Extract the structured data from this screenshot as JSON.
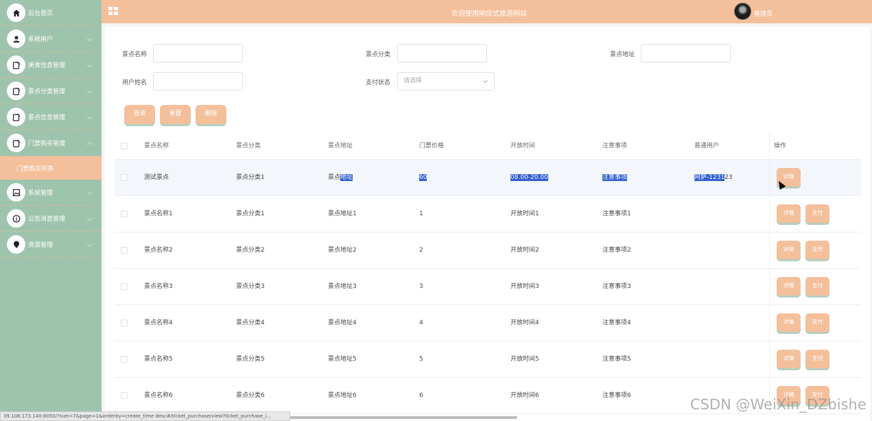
{
  "sidebar": {
    "items": [
      {
        "label": "后台首页",
        "icon": "home-icon"
      },
      {
        "label": "系统用户",
        "icon": "user-icon"
      },
      {
        "label": "美食信息管理",
        "icon": "edit-icon"
      },
      {
        "label": "景点分类管理",
        "icon": "edit-icon"
      },
      {
        "label": "景点信息管理",
        "icon": "edit-icon"
      },
      {
        "label": "门票购买管理",
        "icon": "edit-icon"
      },
      {
        "label": "门票购买列表",
        "icon": ""
      },
      {
        "label": "系统管理",
        "icon": "image-icon"
      },
      {
        "label": "公告消息管理",
        "icon": "info-icon"
      },
      {
        "label": "资源管理",
        "icon": "location-icon"
      }
    ]
  },
  "header": {
    "title": "欢迎使用响应式旅游网站",
    "user": "管理员"
  },
  "filters": {
    "name_label": "景点名称",
    "category_label": "景点分类",
    "address_label": "景点地址",
    "username_label": "用户姓名",
    "pay_status_label": "支付状态",
    "pay_status_placeholder": "请选择"
  },
  "actions": {
    "query": "查询",
    "reset": "重置",
    "delete": "删除"
  },
  "table": {
    "headers": [
      "景点名称",
      "景点分类",
      "景点地址",
      "门票价格",
      "开放时间",
      "注意事项",
      "普通用户",
      "操作"
    ],
    "rows": [
      {
        "name": "测试景点",
        "category": "景点分类1",
        "address_a": "景点",
        "address_b": "地址",
        "price": "60",
        "open": "08.00-20.00",
        "notes": "注意事项",
        "user_a": "阿萨-1231",
        "user_b": "23",
        "detail": "详情",
        "pay": ""
      },
      {
        "name": "景点名称1",
        "category": "景点分类1",
        "address": "景点地址1",
        "price": "1",
        "open": "开放时间1",
        "notes": "注意事项1",
        "user": "",
        "detail": "详情",
        "pay": "支付"
      },
      {
        "name": "景点名称2",
        "category": "景点分类2",
        "address": "景点地址2",
        "price": "2",
        "open": "开放时间2",
        "notes": "注意事项2",
        "user": "",
        "detail": "详情",
        "pay": "支付"
      },
      {
        "name": "景点名称3",
        "category": "景点分类3",
        "address": "景点地址3",
        "price": "3",
        "open": "开放时间3",
        "notes": "注意事项3",
        "user": "",
        "detail": "详情",
        "pay": "支付"
      },
      {
        "name": "景点名称4",
        "category": "景点分类4",
        "address": "景点地址4",
        "price": "4",
        "open": "开放时间4",
        "notes": "注意事项4",
        "user": "",
        "detail": "详情",
        "pay": "支付"
      },
      {
        "name": "景点名称5",
        "category": "景点分类5",
        "address": "景点地址5",
        "price": "5",
        "open": "开放时间5",
        "notes": "注意事项5",
        "user": "",
        "detail": "详情",
        "pay": "支付"
      },
      {
        "name": "景点名称6",
        "category": "景点分类6",
        "address": "景点地址6",
        "price": "6",
        "open": "开放时间6",
        "notes": "注意事项6",
        "user": "",
        "detail": "详情",
        "pay": "支付"
      }
    ]
  },
  "status_bar": "39.108.173.140:8050/?size=7&page=1&orderby=create_time desc#/ticket_purchase/view?ticket_purchase_i...",
  "watermark": "CSDN @WeiXin_DZbishe",
  "colors": {
    "sidebar_bg": "#9fc4ad",
    "accent": "#f4bf9b",
    "selection": "#2f5dd1"
  }
}
